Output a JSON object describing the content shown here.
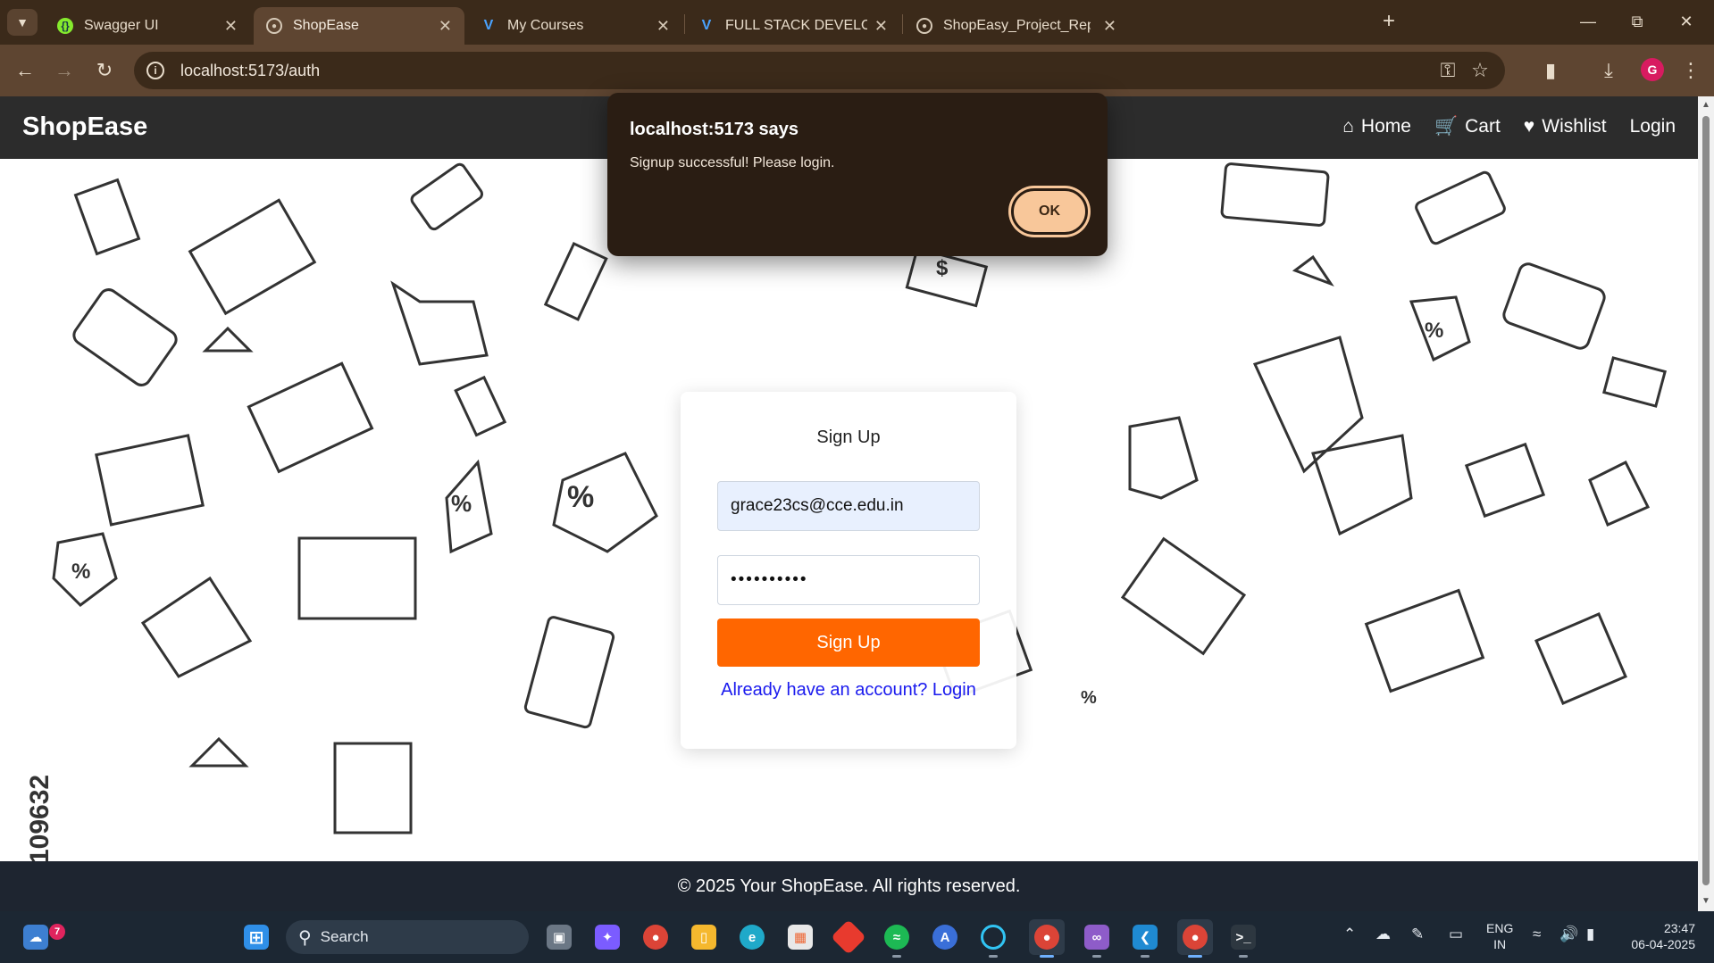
{
  "browser": {
    "tabs": [
      {
        "title": "Swagger UI",
        "favicon": "swagger-icon",
        "active": false
      },
      {
        "title": "ShopEase",
        "favicon": "globe-icon",
        "active": true
      },
      {
        "title": "My Courses",
        "favicon": "vm-logo-icon",
        "active": false
      },
      {
        "title": "FULL STACK DEVELOPMENT - C",
        "favicon": "vm-logo-icon",
        "active": false
      },
      {
        "title": "ShopEasy_Project_Report_GRAC",
        "favicon": "globe-icon",
        "active": false
      }
    ],
    "url": "localhost:5173/auth",
    "profile_initial": "G",
    "colors": {
      "frame": "#3b2a1a",
      "toolbar": "#5e4531"
    }
  },
  "site": {
    "brand": "ShopEase",
    "nav": [
      {
        "label": "Home",
        "icon": "home-icon"
      },
      {
        "label": "Cart",
        "icon": "cart-icon"
      },
      {
        "label": "Wishlist",
        "icon": "heart-icon"
      },
      {
        "label": "Login",
        "icon": ""
      }
    ],
    "auth": {
      "title": "Sign Up",
      "email_value": "grace23cs@cce.edu.in",
      "password_value": "••••••••••",
      "submit_label": "Sign Up",
      "switch_link": "Already have an account? Login"
    },
    "footer": "© 2025 Your ShopEase. All rights reserved.",
    "background_stock_id": "109632",
    "colors": {
      "accent": "#ff6600",
      "header": "#2c2c2c",
      "footer": "#1e2530",
      "link": "#1a1aee"
    }
  },
  "dialog": {
    "title": "localhost:5173 says",
    "message": "Signup successful! Please login.",
    "ok_label": "OK"
  },
  "taskbar": {
    "search_placeholder": "Search",
    "weather_badge": "7",
    "apps": [
      "task-view",
      "copilot",
      "chrome",
      "file-explorer",
      "edge",
      "microsoft-store",
      "git-app",
      "spotify",
      "app-launcher",
      "alexa",
      "chrome",
      "visual-studio",
      "vs-code",
      "chrome-profile",
      "terminal"
    ],
    "lang_top": "ENG",
    "lang_bottom": "IN",
    "time": "23:47",
    "date": "06-04-2025"
  }
}
